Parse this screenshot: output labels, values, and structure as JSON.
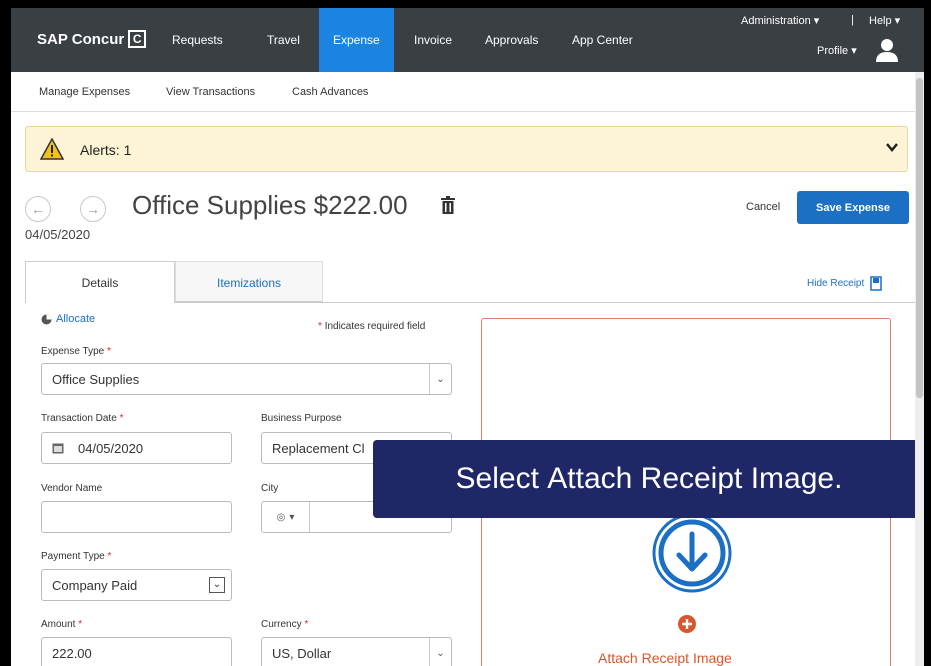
{
  "nav": {
    "logo_text": "SAP Concur",
    "logo_mark": "C",
    "items": [
      "Requests",
      "Travel",
      "Expense",
      "Invoice",
      "Approvals",
      "App Center"
    ],
    "active": "Expense",
    "admin": "Administration ▾",
    "separator": "|",
    "help": "Help ▾",
    "profile": "Profile ▾"
  },
  "subnav": {
    "items": [
      "Manage Expenses",
      "View Transactions",
      "Cash Advances"
    ]
  },
  "alert": {
    "text": "Alerts: 1"
  },
  "expense": {
    "title": "Office Supplies $222.00",
    "date": "04/05/2020",
    "cancel": "Cancel",
    "save": "Save Expense"
  },
  "tabs": {
    "details": "Details",
    "itemizations": "Itemizations",
    "hide_receipt": "Hide Receipt"
  },
  "form": {
    "allocate": "Allocate",
    "required_note": "Indicates required field",
    "required_mark": "*",
    "expense_type_label": "Expense Type",
    "expense_type_value": "Office Supplies",
    "transaction_date_label": "Transaction Date",
    "transaction_date_value": "04/05/2020",
    "business_purpose_label": "Business Purpose",
    "business_purpose_value": "Replacement Cl",
    "vendor_name_label": "Vendor Name",
    "vendor_name_value": "",
    "city_label": "City",
    "city_value": "",
    "payment_type_label": "Payment Type",
    "payment_type_value": "Company Paid",
    "amount_label": "Amount",
    "amount_value": "222.00",
    "currency_label": "Currency",
    "currency_value": "US, Dollar"
  },
  "receipt": {
    "attach_label": "Attach Receipt Image"
  },
  "callout": {
    "prefix": "Select ",
    "emphasis": "Attach Receipt Image",
    "suffix": "."
  },
  "colors": {
    "nav_bg": "#3a3f44",
    "active_tab": "#1b84e0",
    "primary_button": "#1b6fc4",
    "alert_bg": "#fcf4d5",
    "receipt_border": "#d9826b",
    "attach_orange": "#d9552b",
    "callout_bg": "#1f2766"
  }
}
